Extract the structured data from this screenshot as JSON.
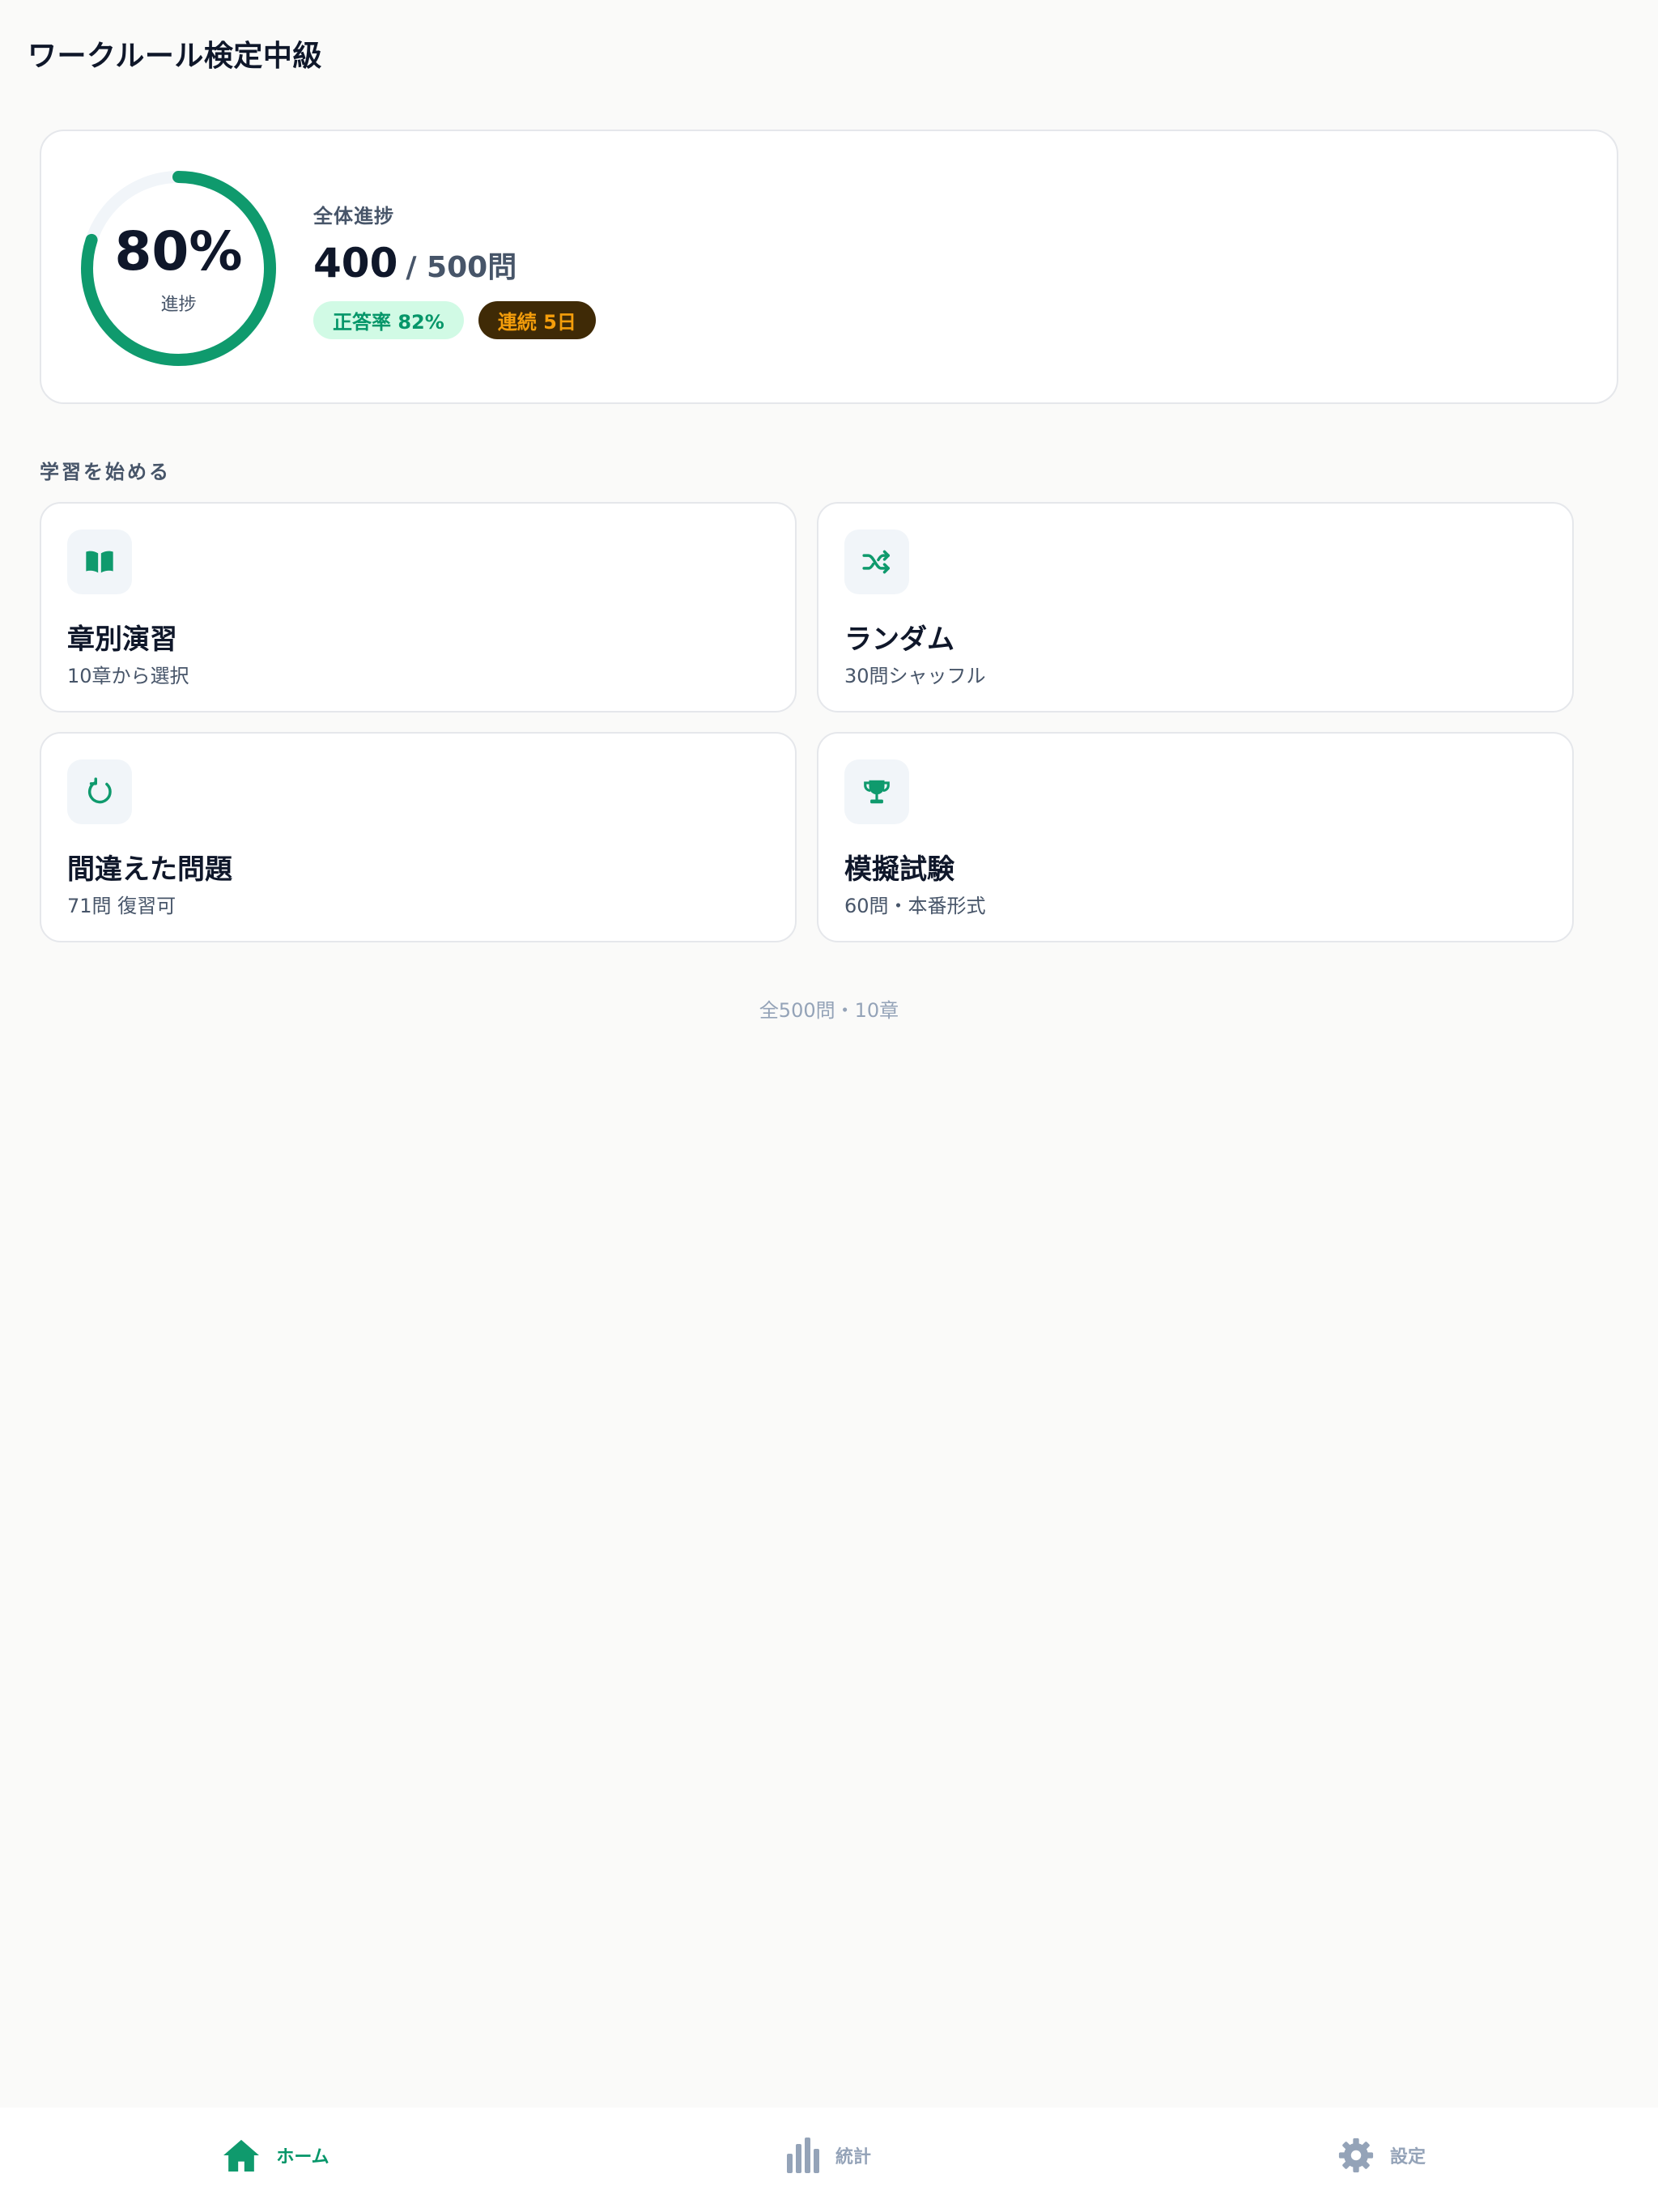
{
  "app": {
    "title": "ワークルール検定中級"
  },
  "colors": {
    "accent": "#0f9a6d",
    "ring_track": "#f1f5f9",
    "accuracy_badge_bg": "#d1fae5",
    "accuracy_badge_text": "#059669",
    "streak_badge_bg": "#3f2a06",
    "streak_badge_text": "#f59e0b",
    "muted": "#94a3b8"
  },
  "progress": {
    "percent": 80,
    "percent_label": "80%",
    "ring_caption": "進捗",
    "section_label": "全体進捗",
    "answered": "400",
    "total_label": "/ 500問",
    "accuracy_badge": "正答率 82%",
    "streak_badge": "連続 5日"
  },
  "study": {
    "section_title": "学習を始める",
    "modes": [
      {
        "title": "章別演習",
        "desc": "10章から選択",
        "icon": "book-open-icon"
      },
      {
        "title": "ランダム",
        "desc": "30問シャッフル",
        "icon": "shuffle-icon"
      },
      {
        "title": "間違えた問題",
        "desc": "71問 復習可",
        "icon": "refresh-icon"
      },
      {
        "title": "模擬試験",
        "desc": "60問・本番形式",
        "icon": "trophy-icon"
      }
    ]
  },
  "footer": {
    "note": "全500問・10章"
  },
  "nav": {
    "items": [
      {
        "label": "ホーム",
        "icon": "home-icon",
        "active": true
      },
      {
        "label": "統計",
        "icon": "bar-chart-icon",
        "active": false
      },
      {
        "label": "設定",
        "icon": "gear-icon",
        "active": false
      }
    ]
  }
}
